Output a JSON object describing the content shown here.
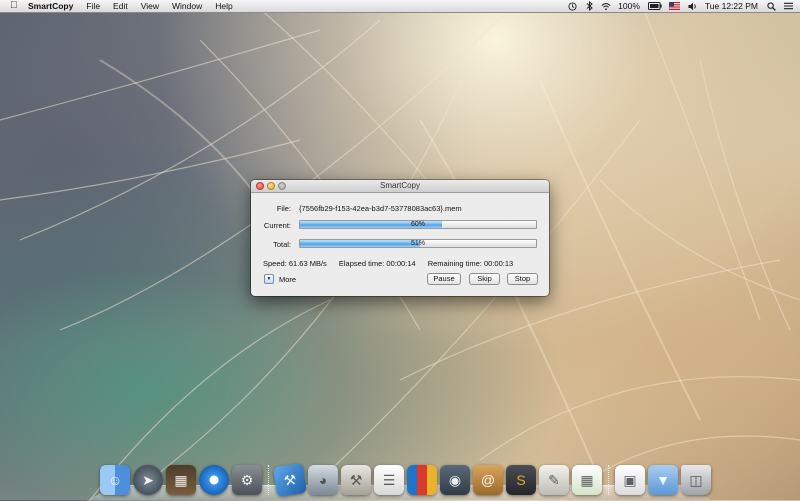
{
  "menubar": {
    "app_name": "SmartCopy",
    "items": [
      "File",
      "Edit",
      "View",
      "Window",
      "Help"
    ],
    "battery_percent": "100%",
    "clock": "Tue 12:22 PM"
  },
  "window": {
    "title": "SmartCopy",
    "file_label": "File:",
    "file_name": "{7556fb29-f153-42ea-b3d7-53778083ac63}.mem",
    "current_label": "Current:",
    "current_progress": 60,
    "current_text": "60%",
    "total_label": "Total:",
    "total_progress": 51,
    "total_text": "51%",
    "speed": "Speed:  61.63 MB/s",
    "elapsed": "Elapsed time:  00:00:14",
    "remaining": "Remaining time:  00:00:13",
    "more_label": "More",
    "buttons": {
      "pause": "Pause",
      "skip": "Skip",
      "stop": "Stop"
    }
  },
  "dock": {
    "icons": [
      "finder-icon",
      "launchpad-icon",
      "mission-control-icon",
      "safari-icon",
      "system-preferences-icon",
      "xcode-icon",
      "instruments-icon",
      "utilities-icon",
      "document-icon",
      "books-icon",
      "photo-icon",
      "address-book-icon",
      "sublime-text-icon",
      "script-editor-icon",
      "spreadsheet-icon",
      "file-icon",
      "downloads-folder-icon",
      "trash-icon"
    ]
  }
}
